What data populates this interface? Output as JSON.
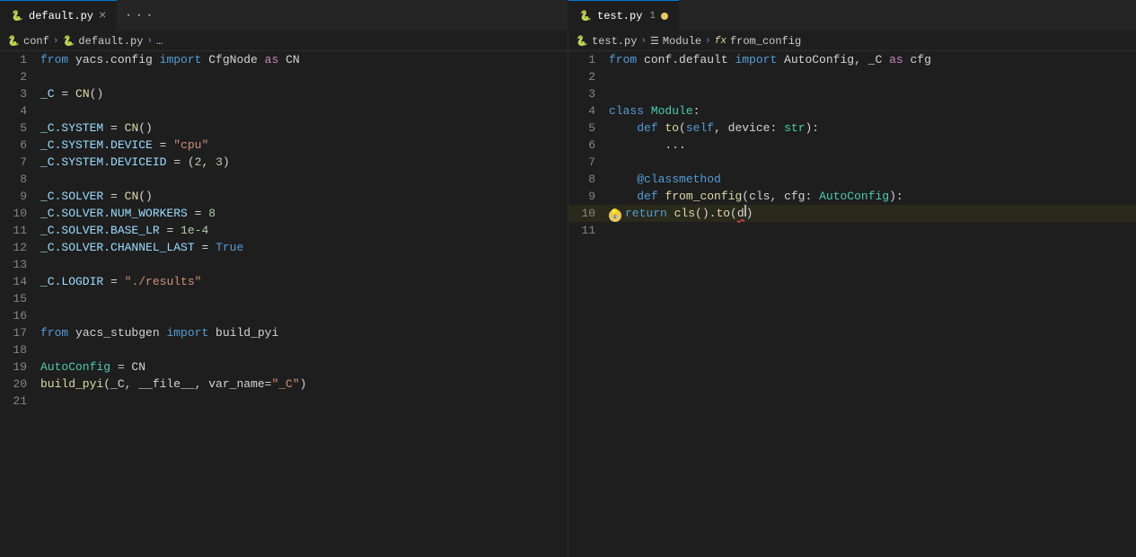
{
  "tabs": {
    "left": {
      "label": "default.py",
      "active": true,
      "icon": "python-icon",
      "modified": false,
      "show_close": true
    },
    "right": {
      "label": "test.py",
      "active": true,
      "icon": "python-icon",
      "modified": true,
      "number": "1"
    }
  },
  "breadcrumbs": {
    "left": [
      "conf",
      "default.py",
      "..."
    ],
    "right": [
      "test.py",
      "Module",
      "from_config"
    ]
  },
  "left_code": [
    {
      "ln": 1,
      "tokens": [
        {
          "t": "kw",
          "v": "from"
        },
        {
          "t": "normal",
          "v": " yacs.config "
        },
        {
          "t": "kw",
          "v": "import"
        },
        {
          "t": "normal",
          "v": " CfgNode "
        },
        {
          "t": "kw2",
          "v": "as"
        },
        {
          "t": "normal",
          "v": " CN"
        }
      ]
    },
    {
      "ln": 2,
      "tokens": []
    },
    {
      "ln": 3,
      "tokens": [
        {
          "t": "var",
          "v": "_C"
        },
        {
          "t": "normal",
          "v": " = "
        },
        {
          "t": "fn",
          "v": "CN"
        },
        {
          "t": "normal",
          "v": "()"
        }
      ]
    },
    {
      "ln": 4,
      "tokens": []
    },
    {
      "ln": 5,
      "tokens": [
        {
          "t": "var",
          "v": "_C.SYSTEM"
        },
        {
          "t": "normal",
          "v": " = "
        },
        {
          "t": "fn",
          "v": "CN"
        },
        {
          "t": "normal",
          "v": "()"
        }
      ]
    },
    {
      "ln": 6,
      "tokens": [
        {
          "t": "var",
          "v": "_C.SYSTEM.DEVICE"
        },
        {
          "t": "normal",
          "v": " = "
        },
        {
          "t": "str",
          "v": "\"cpu\""
        }
      ]
    },
    {
      "ln": 7,
      "tokens": [
        {
          "t": "var",
          "v": "_C.SYSTEM.DEVICEID"
        },
        {
          "t": "normal",
          "v": " = ("
        },
        {
          "t": "num",
          "v": "2"
        },
        {
          "t": "normal",
          "v": ", "
        },
        {
          "t": "num",
          "v": "3"
        },
        {
          "t": "normal",
          "v": ")"
        }
      ]
    },
    {
      "ln": 8,
      "tokens": []
    },
    {
      "ln": 9,
      "tokens": [
        {
          "t": "var",
          "v": "_C.SOLVER"
        },
        {
          "t": "normal",
          "v": " = "
        },
        {
          "t": "fn",
          "v": "CN"
        },
        {
          "t": "normal",
          "v": "()"
        }
      ]
    },
    {
      "ln": 10,
      "tokens": [
        {
          "t": "var",
          "v": "_C.SOLVER.NUM_WORKERS"
        },
        {
          "t": "normal",
          "v": " = "
        },
        {
          "t": "num",
          "v": "8"
        }
      ]
    },
    {
      "ln": 11,
      "tokens": [
        {
          "t": "var",
          "v": "_C.SOLVER.BASE_LR"
        },
        {
          "t": "normal",
          "v": " = "
        },
        {
          "t": "num",
          "v": "1e-4"
        }
      ]
    },
    {
      "ln": 12,
      "tokens": [
        {
          "t": "var",
          "v": "_C.SOLVER.CHANNEL_LAST"
        },
        {
          "t": "normal",
          "v": " = "
        },
        {
          "t": "bool",
          "v": "True"
        }
      ]
    },
    {
      "ln": 13,
      "tokens": []
    },
    {
      "ln": 14,
      "tokens": [
        {
          "t": "var",
          "v": "_C.LOGDIR"
        },
        {
          "t": "normal",
          "v": " = "
        },
        {
          "t": "str",
          "v": "\"./results\""
        }
      ]
    },
    {
      "ln": 15,
      "tokens": []
    },
    {
      "ln": 16,
      "tokens": []
    },
    {
      "ln": 17,
      "tokens": [
        {
          "t": "kw",
          "v": "from"
        },
        {
          "t": "normal",
          "v": " yacs_stubgen "
        },
        {
          "t": "kw",
          "v": "import"
        },
        {
          "t": "normal",
          "v": " build_pyi"
        }
      ]
    },
    {
      "ln": 18,
      "tokens": []
    },
    {
      "ln": 19,
      "tokens": [
        {
          "t": "cls",
          "v": "AutoConfig"
        },
        {
          "t": "normal",
          "v": " = CN"
        }
      ]
    },
    {
      "ln": 20,
      "tokens": [
        {
          "t": "fn",
          "v": "build_pyi"
        },
        {
          "t": "normal",
          "v": "(_C, __file__, var_name="
        },
        {
          "t": "str",
          "v": "\"_C\""
        },
        {
          "t": "normal",
          "v": ")"
        }
      ]
    },
    {
      "ln": 21,
      "tokens": []
    }
  ],
  "right_code": [
    {
      "ln": 1,
      "tokens": [
        {
          "t": "kw",
          "v": "from"
        },
        {
          "t": "normal",
          "v": " conf.default "
        },
        {
          "t": "kw",
          "v": "import"
        },
        {
          "t": "normal",
          "v": " AutoConfig, _C "
        },
        {
          "t": "kw2",
          "v": "as"
        },
        {
          "t": "normal",
          "v": " cfg"
        }
      ]
    },
    {
      "ln": 2,
      "tokens": []
    },
    {
      "ln": 3,
      "tokens": []
    },
    {
      "ln": 4,
      "tokens": [
        {
          "t": "kw",
          "v": "class"
        },
        {
          "t": "normal",
          "v": " "
        },
        {
          "t": "cls",
          "v": "Module"
        },
        {
          "t": "normal",
          "v": ":"
        }
      ]
    },
    {
      "ln": 5,
      "tokens": [
        {
          "t": "normal",
          "v": "    "
        },
        {
          "t": "kw",
          "v": "def"
        },
        {
          "t": "normal",
          "v": " "
        },
        {
          "t": "fn",
          "v": "to"
        },
        {
          "t": "normal",
          "v": "("
        },
        {
          "t": "self-kw",
          "v": "self"
        },
        {
          "t": "normal",
          "v": ", device: "
        },
        {
          "t": "type",
          "v": "str"
        },
        {
          "t": "normal",
          "v": "):"
        }
      ]
    },
    {
      "ln": 6,
      "tokens": [
        {
          "t": "normal",
          "v": "        "
        },
        {
          "t": "ellipsis",
          "v": "..."
        }
      ]
    },
    {
      "ln": 7,
      "tokens": []
    },
    {
      "ln": 8,
      "tokens": [
        {
          "t": "normal",
          "v": "    "
        },
        {
          "t": "dec",
          "v": "@classmethod"
        }
      ]
    },
    {
      "ln": 9,
      "tokens": [
        {
          "t": "normal",
          "v": "    "
        },
        {
          "t": "kw",
          "v": "def"
        },
        {
          "t": "normal",
          "v": " "
        },
        {
          "t": "fn",
          "v": "from_config"
        },
        {
          "t": "normal",
          "v": "(cls, cfg: "
        },
        {
          "t": "type",
          "v": "AutoConfig"
        },
        {
          "t": "normal",
          "v": "):"
        }
      ]
    },
    {
      "ln": 10,
      "tokens": [
        {
          "t": "normal",
          "v": "        "
        },
        {
          "t": "kw",
          "v": "return"
        },
        {
          "t": "normal",
          "v": " "
        },
        {
          "t": "fn",
          "v": "cls"
        },
        {
          "t": "normal",
          "v": "()."
        },
        {
          "t": "fn",
          "v": "to"
        },
        {
          "t": "normal",
          "v": "("
        }
      ],
      "highlight": true,
      "bulb": true,
      "cursor": true
    },
    {
      "ln": 11,
      "tokens": []
    }
  ]
}
